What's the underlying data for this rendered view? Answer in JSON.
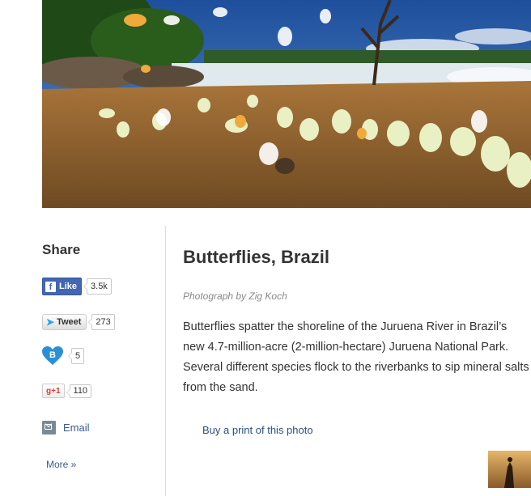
{
  "share": {
    "title": "Share",
    "facebook": {
      "label": "Like",
      "count": "3.5k"
    },
    "twitter": {
      "label": "Tweet",
      "count": "273"
    },
    "bitcoin": {
      "count": "5"
    },
    "googleplus": {
      "label": "g+1",
      "count": "110"
    },
    "email_label": "Email",
    "more_label": "More »"
  },
  "article": {
    "title": "Butterflies, Brazil",
    "credit": "Photograph by Zig Koch",
    "caption": "Butterflies spatter the shoreline of the Juruena River in Brazil’s new 4.7-million-acre (2-million-hectare) Juruena National Park. Several different species flock to the riverbanks to sip mineral salts from the sand.",
    "buy_link": "Buy a print of this photo"
  },
  "colors": {
    "facebook": "#4267b2",
    "twitter_bird": "#2aa3ef",
    "bitcoin_heart": "#2b8fd8",
    "link": "#3a5b8c"
  }
}
